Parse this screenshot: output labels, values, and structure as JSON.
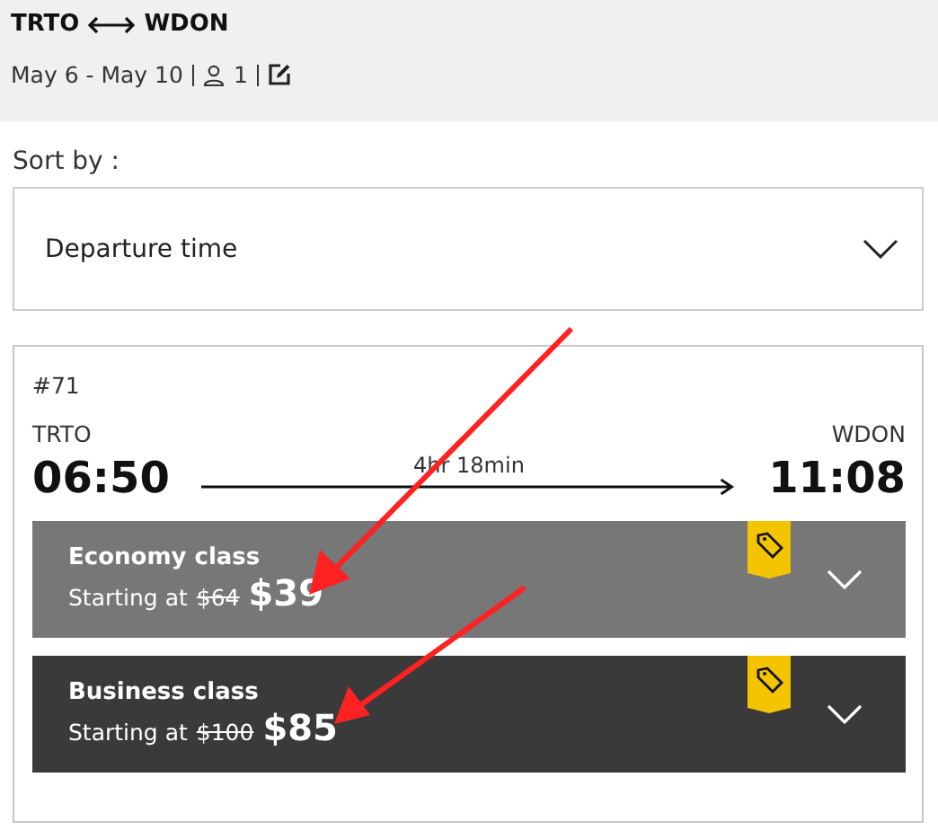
{
  "header": {
    "origin": "TRTO",
    "destination": "WDON",
    "dates": "May 6 - May 10",
    "passengers": "1"
  },
  "sort": {
    "label": "Sort by :",
    "value": "Departure time"
  },
  "trip": {
    "number": "#71",
    "origin": "TRTO",
    "destination": "WDON",
    "departure": "06:50",
    "arrival": "11:08",
    "duration": "4hr 18min",
    "fares": [
      {
        "name": "Economy class",
        "prefix": "Starting at",
        "old_price": "$64",
        "price": "$39",
        "color": "#777777",
        "deal": true
      },
      {
        "name": "Business class",
        "prefix": "Starting at",
        "old_price": "$100",
        "price": "$85",
        "color": "#3a3a3a",
        "deal": true
      }
    ]
  }
}
